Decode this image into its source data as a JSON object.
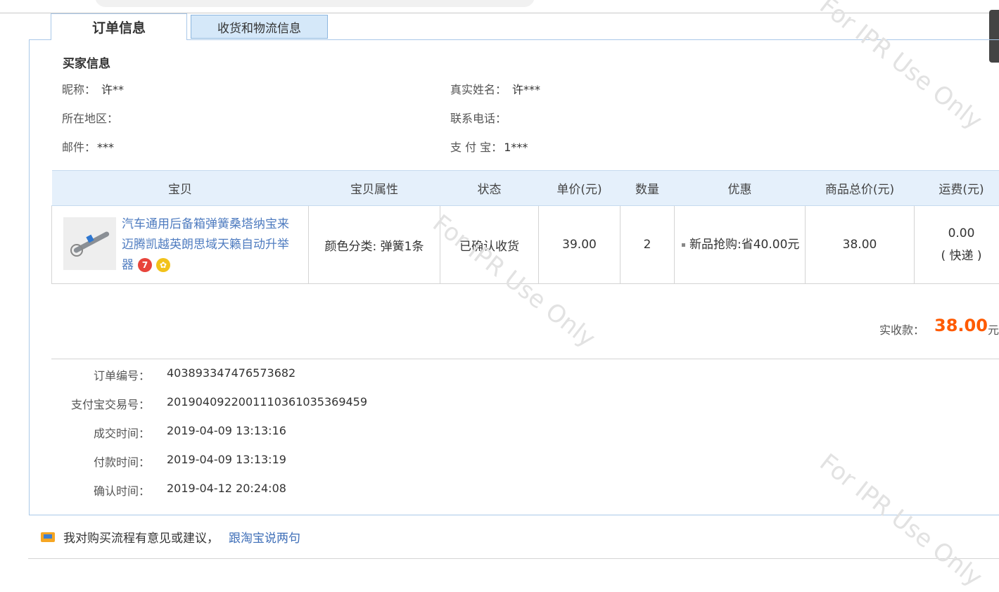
{
  "tabs": {
    "order_info": "订单信息",
    "shipping_info": "收货和物流信息"
  },
  "buyer": {
    "section_title": "买家信息",
    "nickname_label": "昵称：",
    "nickname": "许**",
    "realname_label": "真实姓名：",
    "realname": "许***",
    "region_label": "所在地区：",
    "region": "",
    "phone_label": "联系电话：",
    "phone": "",
    "email_label": "邮件：",
    "email": "***",
    "alipay_label": "支 付 宝：",
    "alipay": "1***"
  },
  "table": {
    "headers": [
      "宝贝",
      "宝贝属性",
      "状态",
      "单价(元)",
      "数量",
      "优惠",
      "商品总价(元)",
      "运费(元)"
    ],
    "row": {
      "title": "汽车通用后备箱弹簧桑塔纳宝来迈腾凯越英朗思域天籁自动升举器",
      "attribute": "颜色分类: 弹簧1条",
      "status": "已确认收货",
      "unit_price": "39.00",
      "quantity": "2",
      "discount": "新品抢购:省40.00元",
      "total": "38.00",
      "shipping_fee": "0.00",
      "shipping_method": "( 快递 )"
    }
  },
  "payment": {
    "label": "实收款：",
    "amount": "38.00",
    "unit": "元"
  },
  "meta": {
    "order_no_label": "订单编号：",
    "order_no": "403893347476573682",
    "alipay_tx_label": "支付宝交易号：",
    "alipay_tx": "2019040922001110361035369459",
    "deal_time_label": "成交时间：",
    "deal_time": "2019-04-09 13:13:16",
    "pay_time_label": "付款时间：",
    "pay_time": "2019-04-09 13:13:19",
    "confirm_time_label": "确认时间：",
    "confirm_time": "2019-04-12 20:24:08"
  },
  "feedback": {
    "text": "我对购买流程有意见或建议，",
    "link": "跟淘宝说两句"
  },
  "watermark": "For IPR Use Only",
  "colors": {
    "accent_orange": "#ff5a00",
    "link_blue": "#4f7cc0",
    "tab_blue": "#d5e8f9",
    "header_blue": "#e5f0fb"
  }
}
